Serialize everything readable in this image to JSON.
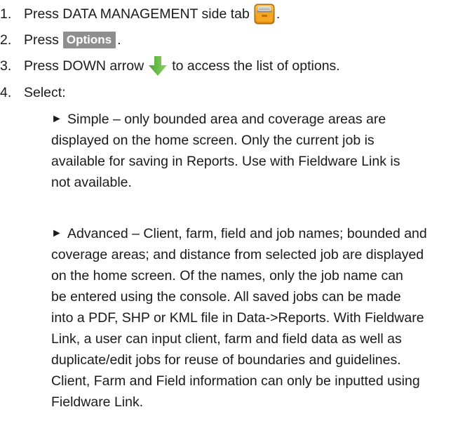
{
  "steps": [
    {
      "number": "1.",
      "text_before": "Press DATA MANAGEMENT side tab",
      "text_after": ".",
      "icon": "data-management-folder-icon"
    },
    {
      "number": "2.",
      "text_before": "Press",
      "button_label": "Options",
      "text_after": "."
    },
    {
      "number": "3.",
      "text_before": "Press DOWN arrow",
      "text_after": "to access the list of options.",
      "icon": "down-arrow-icon"
    },
    {
      "number": "4.",
      "text_before": "Select:"
    }
  ],
  "options": [
    {
      "marker": "►",
      "lines": [
        "Simple – only bounded area and coverage areas are",
        "displayed on the home screen. Only the current job is",
        "available for saving in Reports. Use with Fieldware Link is",
        "not available."
      ]
    },
    {
      "marker": "►",
      "lines": [
        "Advanced – Client, farm, field and job names; bounded and",
        "coverage areas; and distance from selected job are displayed",
        "on the home screen. Of the names, only the job name can",
        "be entered using the console.  All saved jobs can be made",
        "into a PDF, SHP or KML file in Data->Reports. With Fieldware",
        "Link, a user can input client, farm and field data as well as",
        "duplicate/edit jobs for reuse of boundaries and guidelines.",
        "Client, Farm and Field information can only be inputted using",
        "Fieldware Link."
      ]
    }
  ],
  "colors": {
    "text": "#1a1a1a",
    "options_button_bg": "#8e8e8e",
    "folder_icon_orange": "#f0a020",
    "arrow_green": "#6cc04a"
  }
}
